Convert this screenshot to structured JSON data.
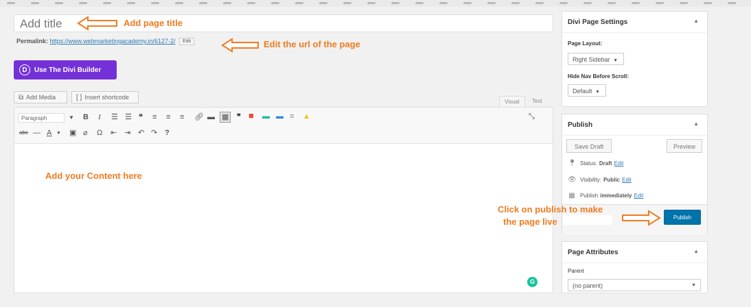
{
  "editor": {
    "title_placeholder": "Add title",
    "permalink_label": "Permalink:",
    "permalink_url": "https://www.webmarketingacademy.in/6127-2/",
    "permalink_edit": "Edit",
    "divi_button": "Use The Divi Builder",
    "divi_letter": "D",
    "add_media": "Add Media",
    "insert_shortcode": "Insert shortcode",
    "tab_visual": "Visual",
    "tab_text": "Text",
    "paragraph_select": "Paragraph",
    "content_hint": "Add your Content here"
  },
  "annotations": {
    "title": "Add page title",
    "url": "Edit the url of the page",
    "publish_line1": "Click on publish to make",
    "publish_line2": "the page live"
  },
  "sidebar": {
    "divi_settings": {
      "title": "Divi Page Settings",
      "page_layout_label": "Page Layout:",
      "page_layout_value": "Right Sidebar",
      "hide_nav_label": "Hide Nav Before Scroll:",
      "hide_nav_value": "Default"
    },
    "publish": {
      "title": "Publish",
      "save_draft": "Save Draft",
      "preview": "Preview",
      "status_label": "Status:",
      "status_value": "Draft",
      "visibility_label": "Visibility:",
      "visibility_value": "Public",
      "publish_label": "Publish",
      "publish_value": "immediately",
      "edit_link": "Edit",
      "publish_button": "Publish"
    },
    "page_attributes": {
      "title": "Page Attributes",
      "parent_label": "Parent",
      "parent_value": "(no parent)"
    }
  },
  "colors": {
    "accent_orange": "#f07b1f",
    "divi_purple": "#7431d8",
    "wp_blue": "#0073aa"
  },
  "icons": [
    "add-media-icon",
    "shortcode-icon",
    "bold-icon",
    "italic-icon",
    "bullet-list-icon",
    "numbered-list-icon",
    "quote-icon",
    "align-left-icon",
    "align-center-icon",
    "align-right-icon",
    "link-icon",
    "read-more-icon",
    "toolbar-toggle-icon",
    "fullscreen-icon",
    "strikethrough-icon",
    "horizontal-line-icon",
    "text-color-icon",
    "paste-text-icon",
    "clear-format-icon",
    "special-char-icon",
    "outdent-icon",
    "indent-icon",
    "undo-icon",
    "redo-icon",
    "help-icon",
    "pin-icon",
    "eye-icon",
    "calendar-icon",
    "grammarly-icon"
  ]
}
